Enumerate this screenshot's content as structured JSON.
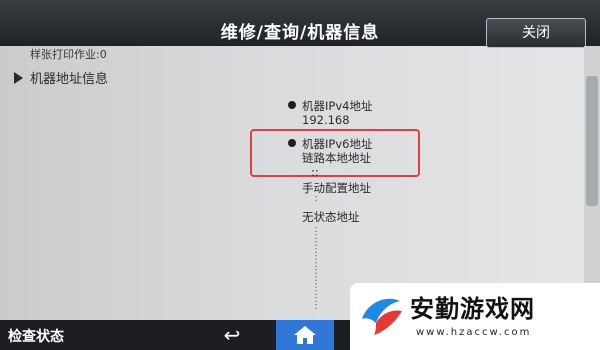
{
  "window": {
    "title": "维修/查询/机器信息",
    "close_label": "关闭"
  },
  "content": {
    "job_count_line": "样张打印作业:0",
    "section_title": "机器地址信息",
    "ipv4": {
      "label": "机器IPv4地址",
      "value": "192.168"
    },
    "ipv6": {
      "label": "机器IPv6地址",
      "link_local_label": "链路本地地址",
      "link_local_value": "::",
      "manual_label": "手动配置地址",
      "stateless_label": "无状态地址",
      "separator": ":"
    }
  },
  "bottom_bar": {
    "status_label": "检查状态",
    "back_icon": "back-arrow-icon",
    "home_icon": "home-icon"
  },
  "logo": {
    "brand": "安勤游戏网",
    "domain": "www.hzaccw.com"
  },
  "colors": {
    "highlight": "#e04040",
    "home_button": "#2f77d6",
    "titlebar": "#2a2d31"
  }
}
